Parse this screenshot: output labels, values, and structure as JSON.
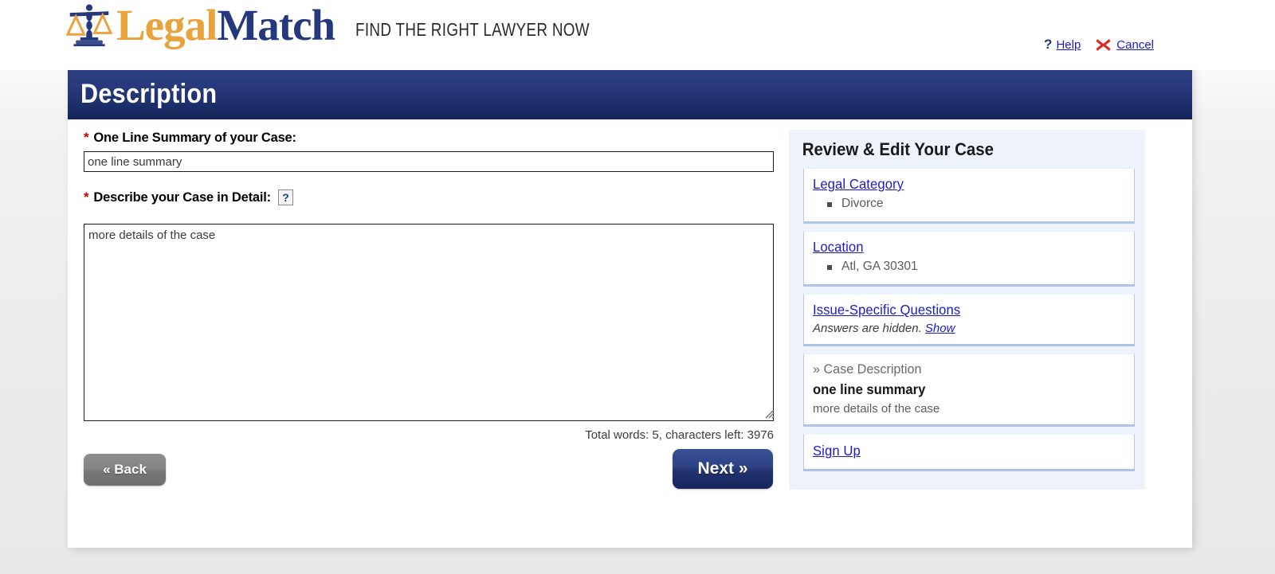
{
  "brand": {
    "logo_primary": "Legal",
    "logo_secondary": "Match",
    "tagline": "FIND THE RIGHT LAWYER NOW",
    "logo_icon": "scales-of-justice-icon",
    "colors": {
      "gold": "#e8a33d",
      "navy": "#25387c",
      "link_blue": "#1a1ad6",
      "required_red": "#cc0000",
      "sidebar_bg": "#eef2fb"
    }
  },
  "topnav": {
    "help_marker": "?",
    "help_label": "Help",
    "cancel_icon": "red-x-icon",
    "cancel_label": "Cancel"
  },
  "banner": {
    "title": "Description"
  },
  "form": {
    "required_marker": "*",
    "summary_label": "One Line Summary of your Case:",
    "summary_value": "one line summary",
    "detail_label": "Describe your Case in Detail:",
    "detail_help_icon": "question-mark-help-icon",
    "detail_help_glyph": "?",
    "detail_value": "more details of the case",
    "word_count": "Total words: 5, characters left: 3976",
    "back_button": "« Back",
    "next_button": "Next »"
  },
  "sidebar": {
    "title": "Review & Edit Your Case",
    "cards": [
      {
        "link": "Legal Category",
        "items": [
          "Divorce"
        ]
      },
      {
        "link": "Location",
        "items": [
          "Atl, GA 30301"
        ]
      },
      {
        "link": "Issue-Specific Questions",
        "note": "Answers are hidden.",
        "note_link": "Show"
      },
      {
        "heading": "» Case Description",
        "summary": "one line summary",
        "detail": "more details of the case"
      },
      {
        "link": "Sign Up"
      }
    ]
  }
}
